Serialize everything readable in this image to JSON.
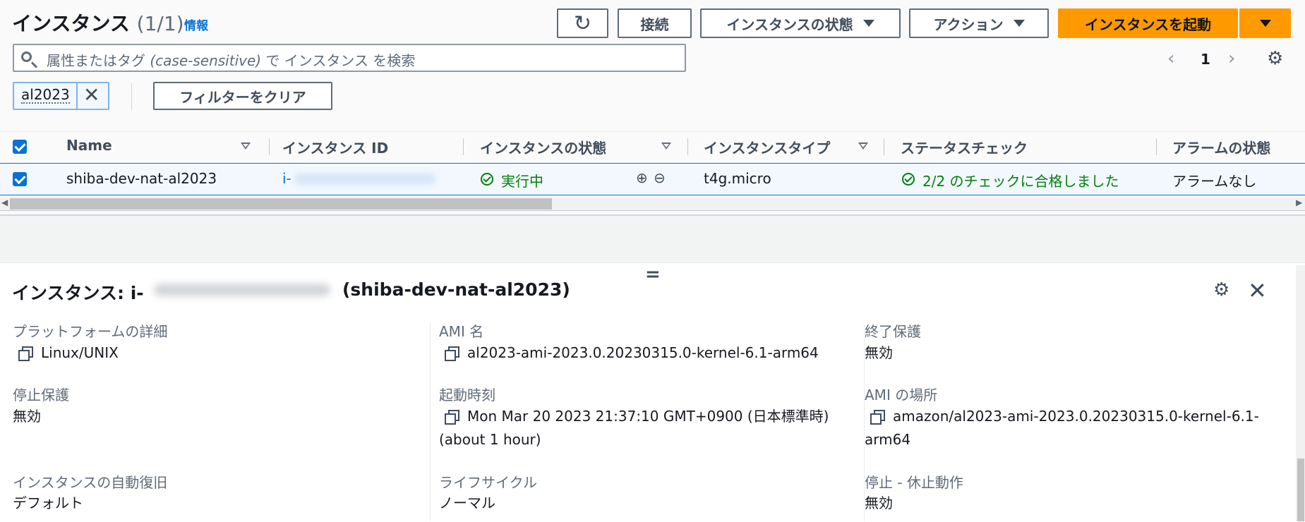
{
  "header": {
    "title": "インスタンス",
    "count": "(1/1)",
    "info_link": "情報"
  },
  "toolbar": {
    "connect_label": "接続",
    "instance_state_label": "インスタンスの状態",
    "actions_label": "アクション",
    "launch_label": "インスタンスを起動"
  },
  "search": {
    "placeholder_prefix": "属性またはタグ ",
    "placeholder_italic": "(case-sensitive)",
    "placeholder_suffix": " で インスタンス を検索"
  },
  "pagination": {
    "page": "1",
    "prev": "‹",
    "next": "›"
  },
  "filter": {
    "token": "al2023",
    "clear_label": "フィルターをクリア"
  },
  "table": {
    "columns": [
      "Name",
      "インスタンス ID",
      "インスタンスの状態",
      "インスタンスタイプ",
      "ステータスチェック",
      "アラームの状態"
    ],
    "rows": [
      {
        "name": "shiba-dev-nat-al2023",
        "instance_id_prefix": "i-",
        "state": "実行中",
        "type": "t4g.micro",
        "status_check": "2/2 のチェックに合格しました",
        "alarm": "アラームなし"
      }
    ]
  },
  "detail": {
    "title_prefix": "インスタンス: i-",
    "title_name": "(shiba-dev-nat-al2023)",
    "fields": [
      {
        "label": "プラットフォームの詳細",
        "value": "Linux/UNIX"
      },
      {
        "label": "AMI 名",
        "value": "al2023-ami-2023.0.20230315.0-kernel-6.1-arm64"
      },
      {
        "label": "終了保護",
        "value": "無効"
      },
      {
        "label": "停止保護",
        "value": "無効"
      },
      {
        "label": "起動時刻",
        "value": "Mon Mar 20 2023 21:37:10 GMT+0900 (日本標準時)",
        "value2": "(about 1 hour)"
      },
      {
        "label": "AMI の場所",
        "value": "amazon/al2023-ami-2023.0.20230315.0-kernel-6.1-",
        "value2": "arm64"
      },
      {
        "label": "インスタンスの自動復旧",
        "value": "デフォルト"
      },
      {
        "label": "ライフサイクル",
        "value": "ノーマル"
      },
      {
        "label": "停止 - 休止動作",
        "value": "無効"
      }
    ]
  },
  "icons": {
    "refresh": "↻",
    "gear": "⚙",
    "close": "✕",
    "zoom_in": "⊕",
    "zoom_out": "⊖",
    "split_handle": "="
  },
  "colors": {
    "accent": "#0972d3",
    "launch_button": "#ff9900",
    "success": "#037f0c"
  }
}
